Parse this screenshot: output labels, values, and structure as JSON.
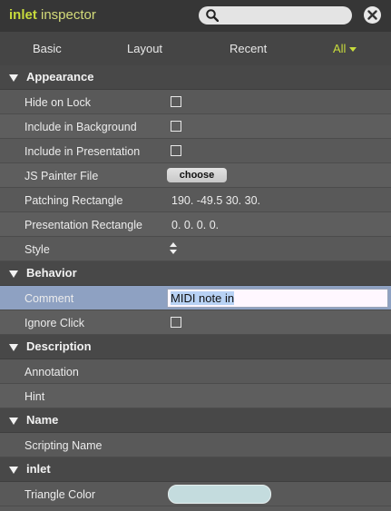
{
  "window": {
    "title_accent": "inlet",
    "title_rest": " inspector",
    "search": {
      "value": ""
    }
  },
  "tabs": [
    {
      "label": "Basic"
    },
    {
      "label": "Layout"
    },
    {
      "label": "Recent"
    },
    {
      "label": "All",
      "active": true
    }
  ],
  "sections": {
    "appearance": {
      "title": "Appearance",
      "hide_on_lock": {
        "label": "Hide on Lock",
        "checked": false
      },
      "include_in_background": {
        "label": "Include in Background",
        "checked": false
      },
      "include_in_presentation": {
        "label": "Include in Presentation",
        "checked": false
      },
      "js_painter_file": {
        "label": "JS Painter File",
        "button": "choose"
      },
      "patching_rectangle": {
        "label": "Patching Rectangle",
        "value": "190. -49.5 30. 30."
      },
      "presentation_rectangle": {
        "label": "Presentation Rectangle",
        "value": "0. 0. 0. 0."
      },
      "style": {
        "label": "Style"
      }
    },
    "behavior": {
      "title": "Behavior",
      "comment": {
        "label": "Comment",
        "value": "MIDI note in"
      },
      "ignore_click": {
        "label": "Ignore Click",
        "checked": false
      }
    },
    "description": {
      "title": "Description",
      "annotation": {
        "label": "Annotation"
      },
      "hint": {
        "label": "Hint"
      }
    },
    "name": {
      "title": "Name",
      "scripting_name": {
        "label": "Scripting Name"
      }
    },
    "inlet": {
      "title": "inlet",
      "triangle_color": {
        "label": "Triangle Color",
        "color": "#c4dcde"
      }
    }
  },
  "colors": {
    "accent": "#c8dc3c",
    "selected_row": "#8ea1c2",
    "panel_bg": "#5a5a5a",
    "section_bg": "#484848"
  }
}
